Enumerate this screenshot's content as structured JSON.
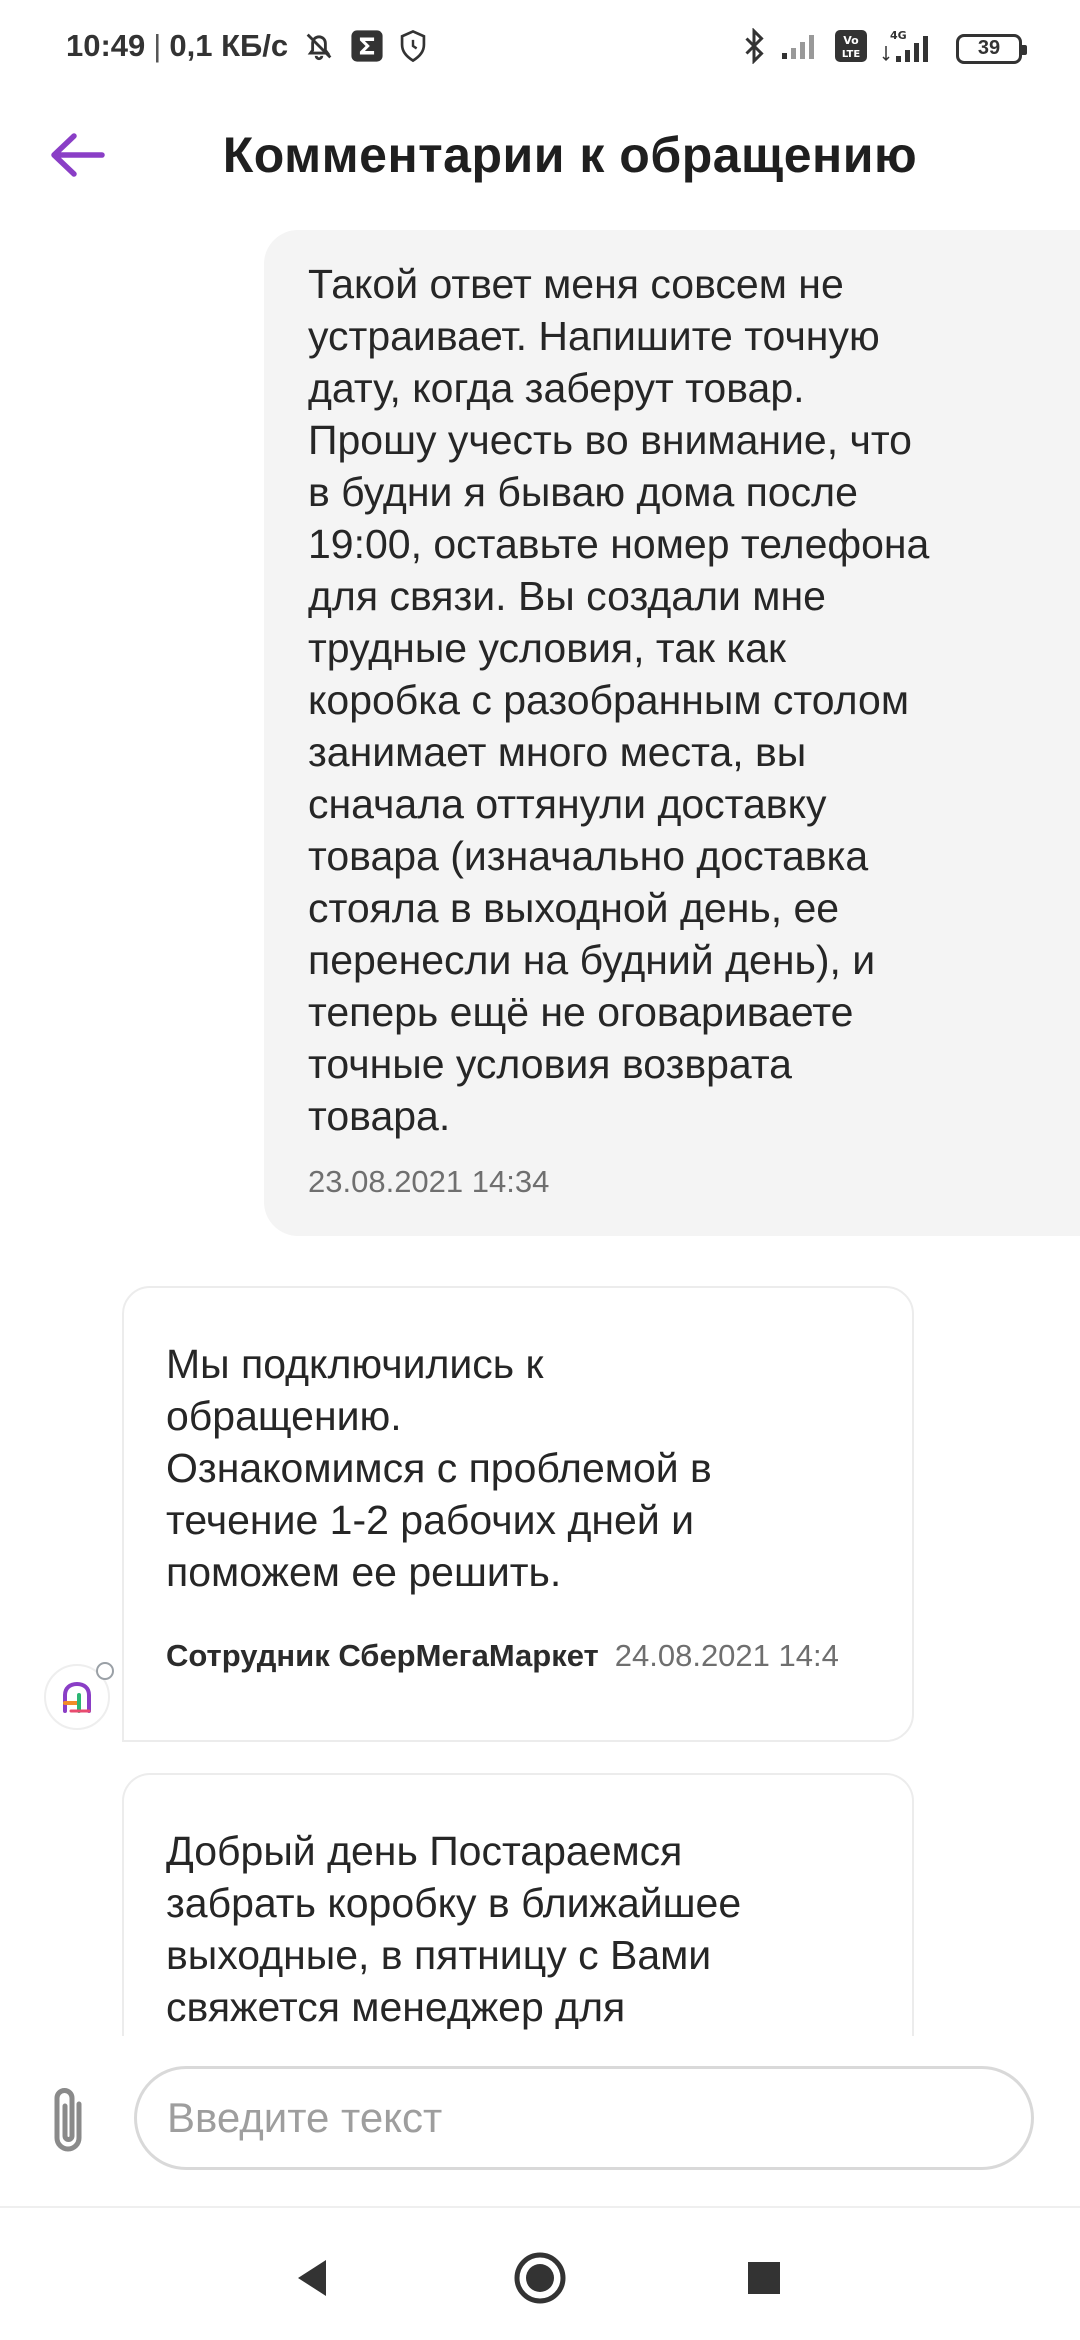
{
  "status_bar": {
    "time": "10:49",
    "separator": "|",
    "net_speed": "0,1 КБ/с",
    "battery": "39",
    "network_4g": "4G",
    "volte": "Vo LTE"
  },
  "header": {
    "title": "Комментарии к обращению"
  },
  "messages": [
    {
      "text": "Такой ответ меня совсем не\nустраивает. Напишите точную\nдату, когда заберут товар.\nПрошу учесть во внимание, что\nв будни я бываю дома после\n19:00, оставьте номер телефона\nдля связи. Вы создали мне\nтрудные условия, так как\nкоробка с разобранным столом\nзанимает много места, вы\nсначала оттянули доставку\nтовара (изначально доставка\nстояла в выходной день, ее\nперенесли на будний день), и\nтеперь ещё не оговариваете\nточные условия возврата\nтовара.",
      "time": "23.08.2021 14:34"
    },
    {
      "text": "Мы подключились к\nобращению.\nОзнакомимся с проблемой в\nтечение 1-2 рабочих дней и\nпоможем ее решить.",
      "author": "Сотрудник СберМегаМаркет",
      "time": "24.08.2021 14:4"
    },
    {
      "text": "Добрый день Постараемся\nзабрать коробку в ближайшее\nвыходные, в пятницу с Вами\nсвяжется менеджер для"
    }
  ],
  "composer": {
    "placeholder": "Введите текст",
    "value": ""
  },
  "colors": {
    "accent": "#8a3ec6",
    "user_bubble": "#f4f4f4",
    "timestamp": "#6f6f6f"
  },
  "icons": {
    "back": "arrow-left-icon",
    "attach": "paperclip-icon",
    "nav_back": "triangle-back-icon",
    "nav_home": "circle-home-icon",
    "nav_recents": "square-recents-icon"
  }
}
